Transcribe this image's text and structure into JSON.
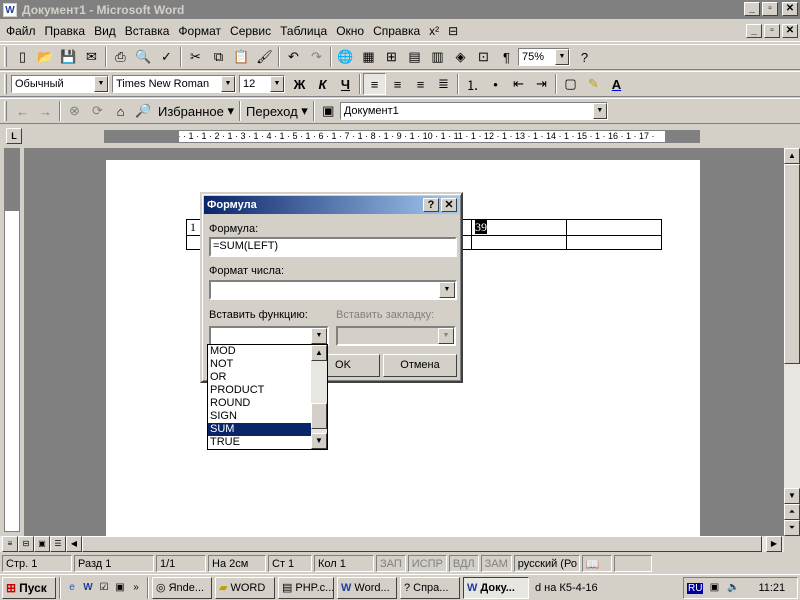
{
  "window": {
    "title": "Документ1 - Microsoft Word"
  },
  "menu": [
    "Файл",
    "Правка",
    "Вид",
    "Вставка",
    "Формат",
    "Сервис",
    "Таблица",
    "Окно",
    "Справка"
  ],
  "toolbar": {
    "zoom": "75%"
  },
  "format_bar": {
    "style": "Обычный",
    "font": "Times New Roman",
    "size": "12",
    "bold": "Ж",
    "italic": "К",
    "underline": "Ч"
  },
  "web_bar": {
    "favorites": "Избранное",
    "goto": "Переход",
    "address": "Документ1"
  },
  "ruler_h": "3 · 1 · 2 · 1 · 1 · 1 ·  · 1 · 1 · 2 · 1 · 3 · 1 · 4 · 1 · 5 · 1 · 6 · 1 · 7 · 1 · 8 · 1 · 9 · 1 · 10 · 1 · 11 · 1 · 12 · 1 · 13 · 1 · 14 · 1 · 15 · 1 · 16 · 1 · 17 ·",
  "document": {
    "cell_first": "1",
    "cell_value": "39"
  },
  "dialog": {
    "title": "Формула",
    "help": "?",
    "close": "✕",
    "formula_label": "Формула:",
    "formula_value": "=SUM(LEFT)",
    "number_format_label": "Формат числа:",
    "number_format_value": "",
    "insert_function_label": "Вставить функцию:",
    "insert_bookmark_label": "Вставить закладку:",
    "ok": "OK",
    "cancel": "Отмена",
    "function_list": [
      "MOD",
      "NOT",
      "OR",
      "PRODUCT",
      "ROUND",
      "SIGN",
      "SUM",
      "TRUE"
    ],
    "selected_function": "SUM"
  },
  "status": {
    "page": "Стр. 1",
    "section": "Разд 1",
    "pages": "1/1",
    "at": "На 2см",
    "line": "Ст 1",
    "col": "Кол 1",
    "rec": "ЗАП",
    "trk": "ИСПР",
    "ext": "ВДЛ",
    "ovr": "ЗАМ",
    "lang": "русский (Ро"
  },
  "taskbar": {
    "start": "Пуск",
    "tasks": [
      "Яnde...",
      "WORD",
      "PHP.c...",
      "Word...",
      "Спра...",
      "Доку...",
      "d на К5-4-16"
    ],
    "lang": "RU",
    "clock": "11:21"
  }
}
